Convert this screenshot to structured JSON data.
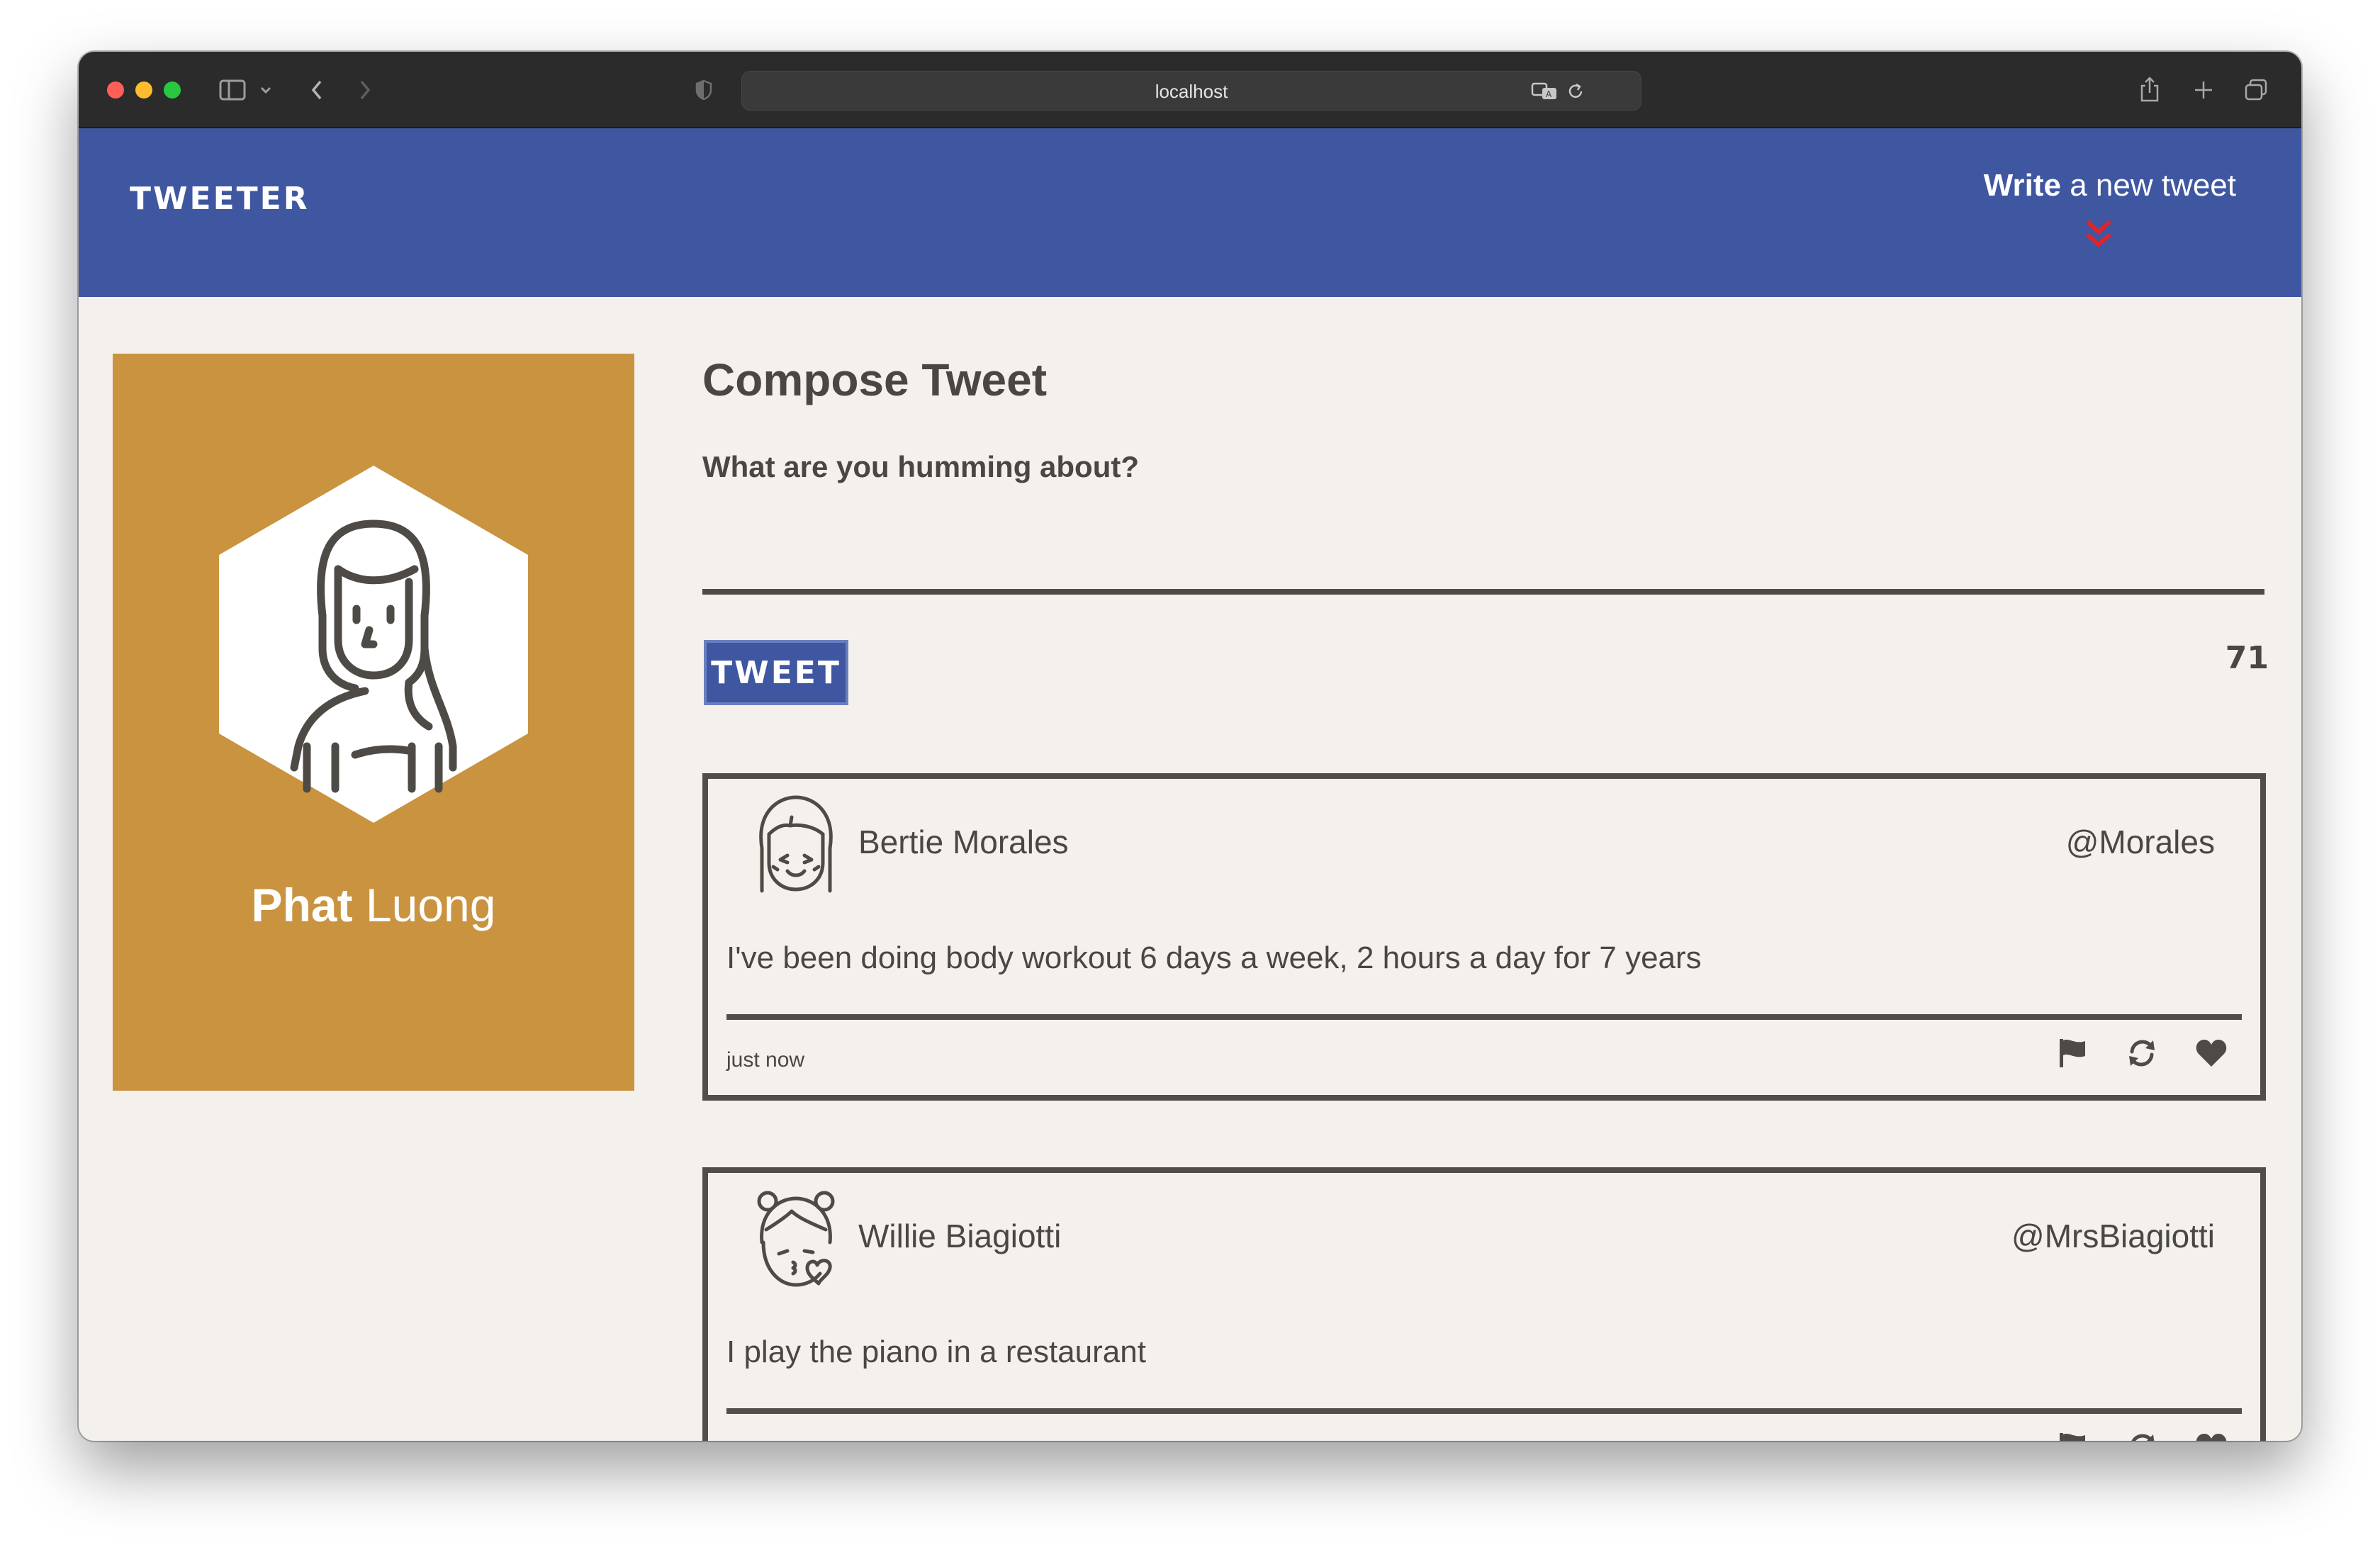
{
  "browser": {
    "url": "localhost"
  },
  "nav": {
    "logo": "TWEETER",
    "write_bold": "Write",
    "write_rest": " a new tweet"
  },
  "profile": {
    "first_name": "Phat",
    "last_name": "Luong",
    "background_color": "#c9933f"
  },
  "compose": {
    "title": "Compose Tweet",
    "label": "What are you humming about?",
    "textarea_value": "",
    "button_label": "TWEET",
    "counter": "71"
  },
  "tweets": [
    {
      "name": "Bertie Morales",
      "handle": "@Morales",
      "text": "I've been doing body workout 6 days a week, 2 hours a day for 7 years",
      "time": "just now",
      "avatar_icon": "girl-bangs-avatar-icon"
    },
    {
      "name": "Willie Biagiotti",
      "handle": "@MrsBiagiotti",
      "text": "I play the piano in a restaurant",
      "time": "",
      "avatar_icon": "girl-kiss-avatar-icon"
    }
  ],
  "colors": {
    "nav": "#3f56a1",
    "page_bg": "#f4f1ec",
    "text": "#4a4742",
    "chevron": "#e0242b"
  }
}
